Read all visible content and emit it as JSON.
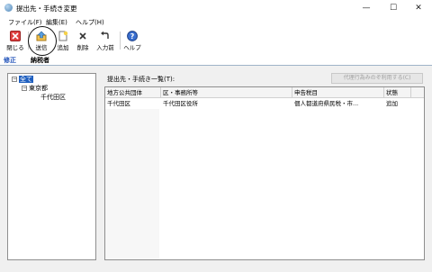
{
  "window": {
    "title": "提出先・手続き変更",
    "controls": {
      "minimize": "—",
      "maximize": "☐",
      "close": "✕"
    }
  },
  "menu": [
    "ファイル(F)",
    "編集(E)",
    "ヘルプ(H)"
  ],
  "toolbar": {
    "close_label": "閉じる",
    "send_label": "送信",
    "add_label": "追加",
    "delete_label": "削除",
    "input_prev_label": "入力前",
    "help_label": "ヘルプ"
  },
  "mode_tabs": [
    "修正",
    "納税者"
  ],
  "tree": {
    "root_label": "全て",
    "pref_label": "東京都",
    "city_label": "千代田区"
  },
  "panel": {
    "title": "提出先・手続き一覧(T):",
    "bulk_button": "代理行為みのぞ利用する(C)"
  },
  "grid": {
    "columns": [
      "地方公共団体",
      "区・事務所等",
      "申告税目",
      "状態"
    ],
    "rows": [
      [
        "千代田区",
        "千代田区役所",
        "個人都道府県民税・市...",
        "追加"
      ]
    ]
  }
}
